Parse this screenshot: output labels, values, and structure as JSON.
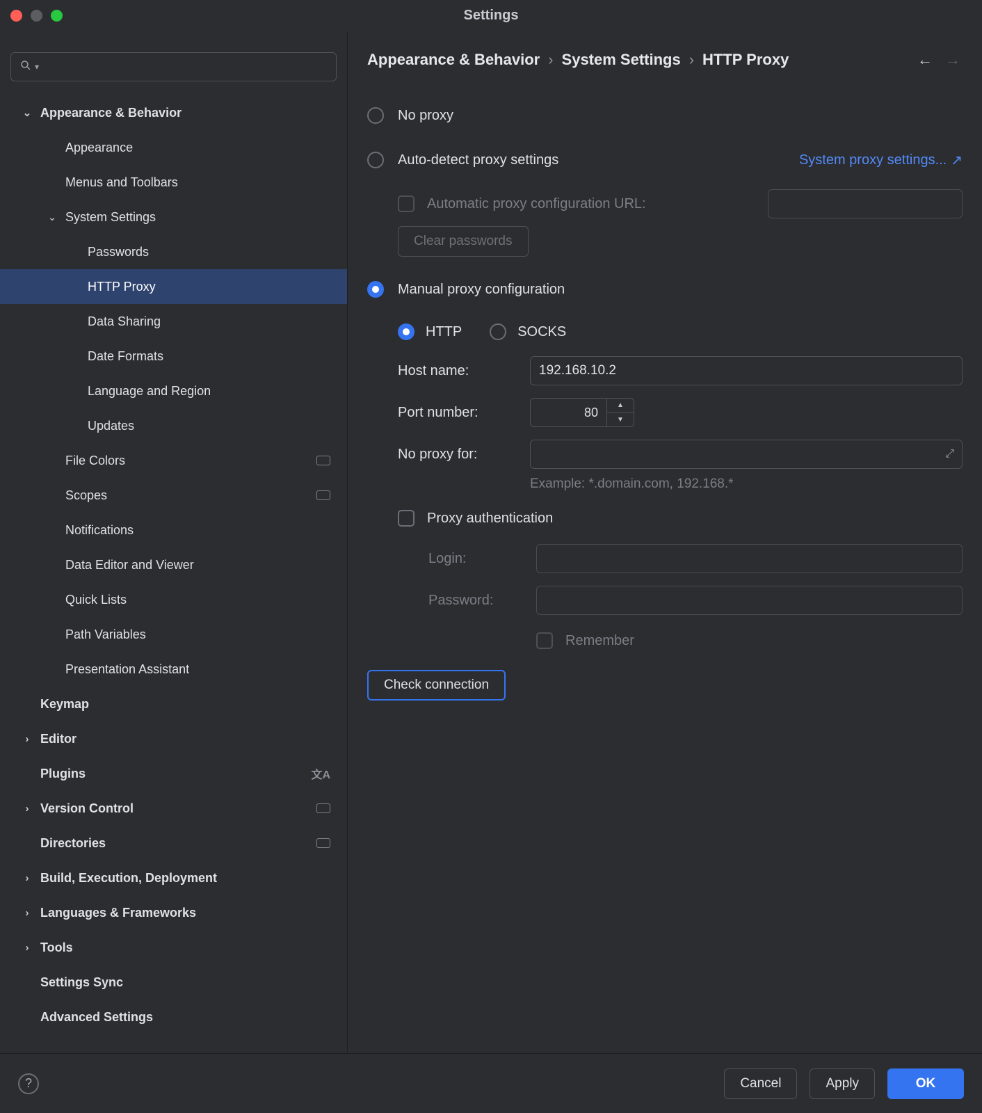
{
  "window_title": "Settings",
  "breadcrumbs": [
    "Appearance & Behavior",
    "System Settings",
    "HTTP Proxy"
  ],
  "sidebar": {
    "items": [
      {
        "label": "Appearance & Behavior",
        "level": 0,
        "bold": true,
        "caret": "down"
      },
      {
        "label": "Appearance",
        "level": 1
      },
      {
        "label": "Menus and Toolbars",
        "level": 1
      },
      {
        "label": "System Settings",
        "level": 1,
        "caret": "down"
      },
      {
        "label": "Passwords",
        "level": 2
      },
      {
        "label": "HTTP Proxy",
        "level": 2,
        "selected": true
      },
      {
        "label": "Data Sharing",
        "level": 2
      },
      {
        "label": "Date Formats",
        "level": 2
      },
      {
        "label": "Language and Region",
        "level": 2
      },
      {
        "label": "Updates",
        "level": 2
      },
      {
        "label": "File Colors",
        "level": 1,
        "tag": true
      },
      {
        "label": "Scopes",
        "level": 1,
        "tag": true
      },
      {
        "label": "Notifications",
        "level": 1
      },
      {
        "label": "Data Editor and Viewer",
        "level": 1
      },
      {
        "label": "Quick Lists",
        "level": 1
      },
      {
        "label": "Path Variables",
        "level": 1
      },
      {
        "label": "Presentation Assistant",
        "level": 1
      },
      {
        "label": "Keymap",
        "level": 0,
        "bold": true,
        "caret": "none"
      },
      {
        "label": "Editor",
        "level": 0,
        "bold": true,
        "caret": "right"
      },
      {
        "label": "Plugins",
        "level": 0,
        "bold": true,
        "caret": "none",
        "glyph": "lang"
      },
      {
        "label": "Version Control",
        "level": 0,
        "bold": true,
        "caret": "right",
        "tag": true
      },
      {
        "label": "Directories",
        "level": 0,
        "bold": true,
        "caret": "none",
        "tag": true
      },
      {
        "label": "Build, Execution, Deployment",
        "level": 0,
        "bold": true,
        "caret": "right"
      },
      {
        "label": "Languages & Frameworks",
        "level": 0,
        "bold": true,
        "caret": "right"
      },
      {
        "label": "Tools",
        "level": 0,
        "bold": true,
        "caret": "right"
      },
      {
        "label": "Settings Sync",
        "level": 0,
        "bold": true,
        "caret": "none"
      },
      {
        "label": "Advanced Settings",
        "level": 0,
        "bold": true,
        "caret": "none"
      }
    ]
  },
  "proxy": {
    "no_proxy_label": "No proxy",
    "auto_detect_label": "Auto-detect proxy settings",
    "system_link": "System proxy settings...",
    "auto_url_label": "Automatic proxy configuration URL:",
    "auto_url_value": "",
    "clear_passwords": "Clear passwords",
    "manual_label": "Manual proxy configuration",
    "http_label": "HTTP",
    "socks_label": "SOCKS",
    "host_label": "Host name:",
    "host_value": "192.168.10.2",
    "port_label": "Port number:",
    "port_value": "80",
    "noproxyfor_label": "No proxy for:",
    "noproxyfor_value": "",
    "example": "Example: *.domain.com, 192.168.*",
    "auth_label": "Proxy authentication",
    "login_label": "Login:",
    "login_value": "",
    "password_label": "Password:",
    "password_value": "",
    "remember_label": "Remember",
    "check_connection": "Check connection"
  },
  "footer": {
    "cancel": "Cancel",
    "apply": "Apply",
    "ok": "OK"
  }
}
